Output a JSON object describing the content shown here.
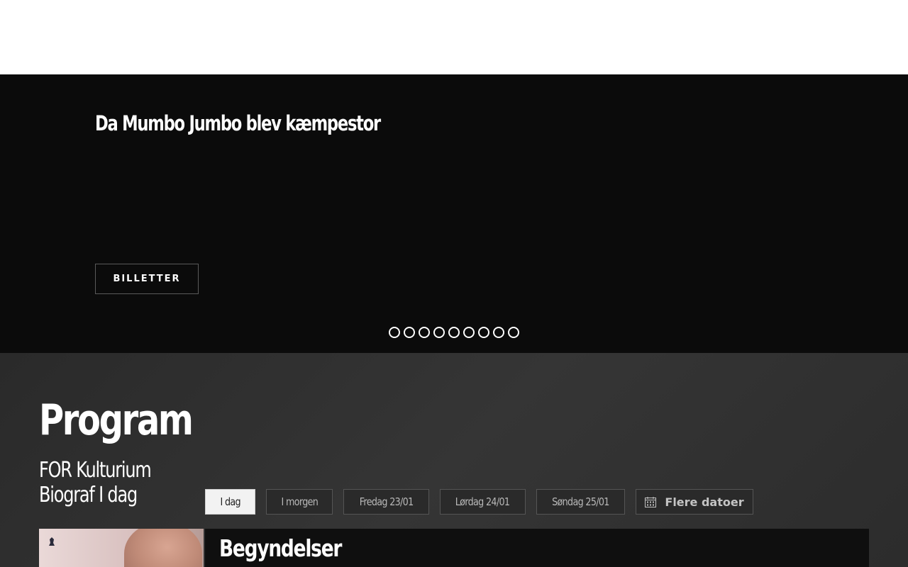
{
  "hero": {
    "title": "Da Mumbo Jumbo blev kæmpestor",
    "button_label": "BILLETTER",
    "slide_count": 9
  },
  "program": {
    "title": "Program",
    "subtitle_line1": "FOR Kulturium",
    "subtitle_line2": "Biograf I dag",
    "tabs": [
      {
        "label": "I dag",
        "active": true
      },
      {
        "label": "I morgen",
        "active": false
      },
      {
        "label": "Fredag 23/01",
        "active": false
      },
      {
        "label": "Lørdag 24/01",
        "active": false
      },
      {
        "label": "Søndag 25/01",
        "active": false
      }
    ],
    "more_dates_label": "Flere datoer",
    "more_dates_icon": "calendar-icon"
  },
  "movie": {
    "title": "Begyndelser"
  },
  "colors": {
    "hero_bg": "#0b0b0b",
    "program_bg": "#2f2f2f",
    "active_tab_bg": "#f2f2f2",
    "movie_info_bg": "#0f0f0f"
  }
}
